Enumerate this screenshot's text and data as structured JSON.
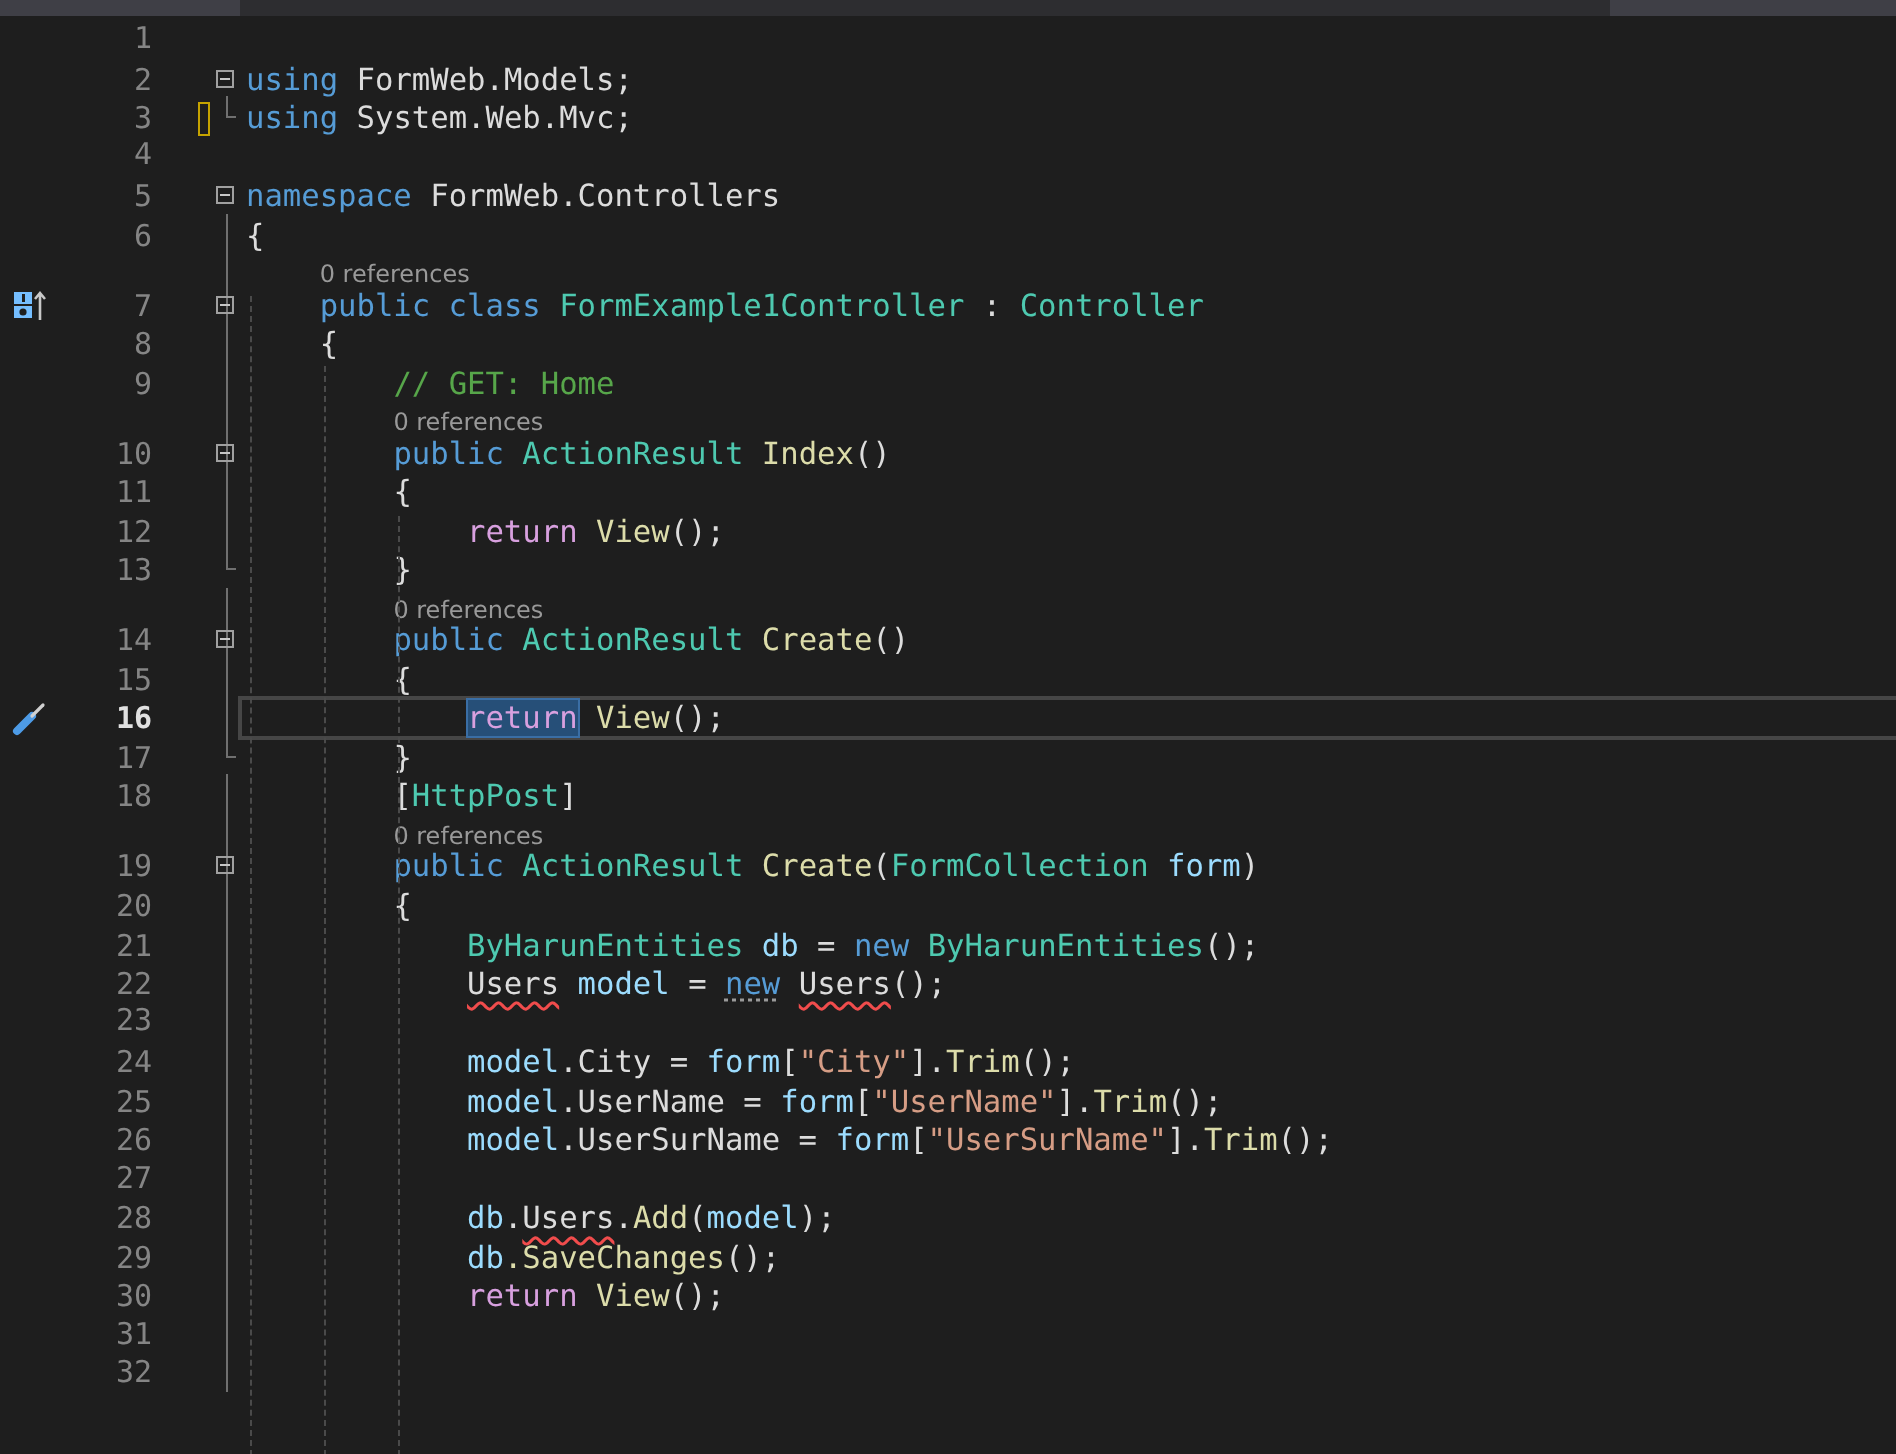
{
  "lines": [
    {
      "n": "1"
    },
    {
      "n": "2",
      "kind": "start",
      "tokens": [
        {
          "kind": "kw",
          "text": "using"
        },
        {
          "kind": "plain",
          "text": " FormWeb.Models;"
        }
      ]
    },
    {
      "n": "3",
      "kind": "end",
      "changed": true,
      "tokens": [
        {
          "kind": "kw",
          "text": "using"
        },
        {
          "kind": "plain",
          "text": " System.Web.Mvc;"
        }
      ]
    },
    {
      "n": "4"
    },
    {
      "n": "5",
      "kind": "start",
      "tokens": [
        {
          "kind": "kw",
          "text": "namespace"
        },
        {
          "kind": "plain",
          "text": " FormWeb.Controllers"
        }
      ]
    },
    {
      "n": "6",
      "kind": "body",
      "tokens": [
        {
          "kind": "plain",
          "text": "{"
        }
      ]
    },
    {
      "n": "7",
      "kind": "start",
      "diagram": true,
      "lens": "0 references",
      "tokens": [
        {
          "kind": "kw",
          "text": "    public class "
        },
        {
          "kind": "type",
          "text": "FormExample1Controller"
        },
        {
          "kind": "plain",
          "text": " : "
        },
        {
          "kind": "type",
          "text": "Controller"
        }
      ]
    },
    {
      "n": "8",
      "kind": "body",
      "tokens": [
        {
          "kind": "plain",
          "text": "    {"
        }
      ]
    },
    {
      "n": "9",
      "kind": "body",
      "tokens": [
        {
          "kind": "cmt",
          "text": "        // GET: Home"
        }
      ]
    },
    {
      "n": "10",
      "kind": "start",
      "lens": "0 references",
      "tokens": [
        {
          "kind": "kw",
          "text": "        public "
        },
        {
          "kind": "type",
          "text": "ActionResult "
        },
        {
          "kind": "fn",
          "text": "Index"
        },
        {
          "kind": "plain",
          "text": "()"
        }
      ]
    },
    {
      "n": "11",
      "kind": "body",
      "tokens": [
        {
          "kind": "plain",
          "text": "        {"
        }
      ]
    },
    {
      "n": "12",
      "kind": "body",
      "tokens": [
        {
          "kind": "ctl",
          "text": "            return "
        },
        {
          "kind": "fn",
          "text": "View"
        },
        {
          "kind": "plain",
          "text": "();"
        }
      ]
    },
    {
      "n": "13",
      "kind": "end",
      "tokens": [
        {
          "kind": "plain",
          "text": "        }"
        }
      ]
    },
    {
      "n": "14",
      "kind": "start",
      "lens": "0 references",
      "tokens": [
        {
          "kind": "kw",
          "text": "        public "
        },
        {
          "kind": "type",
          "text": "ActionResult "
        },
        {
          "kind": "fn",
          "text": "Create"
        },
        {
          "kind": "plain",
          "text": "()"
        }
      ]
    },
    {
      "n": "15",
      "kind": "body",
      "tokens": [
        {
          "kind": "plain",
          "text": "        {"
        }
      ]
    },
    {
      "n": "16",
      "kind": "body",
      "current": true,
      "tokens": [
        {
          "kind": "ctl",
          "text": "            return",
          "highlight": true
        },
        {
          "kind": "fn",
          "text": " View"
        },
        {
          "kind": "plain",
          "text": "();"
        }
      ]
    },
    {
      "n": "17",
      "kind": "end",
      "tokens": [
        {
          "kind": "plain",
          "text": "        }"
        }
      ]
    },
    {
      "n": "18",
      "kind": "body",
      "tokens": [
        {
          "kind": "plain",
          "text": "        ["
        },
        {
          "kind": "type",
          "text": "HttpPost"
        },
        {
          "kind": "plain",
          "text": "]"
        }
      ]
    },
    {
      "n": "19",
      "kind": "start",
      "lens": "0 references",
      "tokens": [
        {
          "kind": "kw",
          "text": "        public "
        },
        {
          "kind": "type",
          "text": "ActionResult "
        },
        {
          "kind": "fn",
          "text": "Create"
        },
        {
          "kind": "plain",
          "text": "("
        },
        {
          "kind": "type",
          "text": "FormCollection "
        },
        {
          "kind": "var",
          "text": "form"
        },
        {
          "kind": "plain",
          "text": ")"
        }
      ]
    },
    {
      "n": "20",
      "kind": "body",
      "tokens": [
        {
          "kind": "plain",
          "text": "        {"
        }
      ]
    },
    {
      "n": "21",
      "kind": "body",
      "tokens": [
        {
          "kind": "type",
          "text": "            ByHarunEntities "
        },
        {
          "kind": "var",
          "text": "db"
        },
        {
          "kind": "plain",
          "text": " = "
        },
        {
          "kind": "kw",
          "text": "new "
        },
        {
          "kind": "type",
          "text": "ByHarunEntities"
        },
        {
          "kind": "plain",
          "text": "();"
        }
      ]
    },
    {
      "n": "22",
      "kind": "body",
      "tokens": [
        {
          "kind": "plain",
          "text": "            Users",
          "error": true
        },
        {
          "kind": "var",
          "text": " model"
        },
        {
          "kind": "plain",
          "text": " = "
        },
        {
          "kind": "kw",
          "text": "new ",
          "hint": true
        },
        {
          "kind": "plain",
          "text": "Users",
          "error": true
        },
        {
          "kind": "plain",
          "text": "();"
        }
      ]
    },
    {
      "n": "23",
      "kind": "body"
    },
    {
      "n": "24",
      "kind": "body",
      "tokens": [
        {
          "kind": "var",
          "text": "            model"
        },
        {
          "kind": "plain",
          "text": ".City = "
        },
        {
          "kind": "var",
          "text": "form"
        },
        {
          "kind": "plain",
          "text": "["
        },
        {
          "kind": "str",
          "text": "\"City\""
        },
        {
          "kind": "plain",
          "text": "]."
        },
        {
          "kind": "fn",
          "text": "Trim"
        },
        {
          "kind": "plain",
          "text": "();"
        }
      ]
    },
    {
      "n": "25",
      "kind": "body",
      "tokens": [
        {
          "kind": "var",
          "text": "            model"
        },
        {
          "kind": "plain",
          "text": ".UserName = "
        },
        {
          "kind": "var",
          "text": "form"
        },
        {
          "kind": "plain",
          "text": "["
        },
        {
          "kind": "str",
          "text": "\"UserName\""
        },
        {
          "kind": "plain",
          "text": "]."
        },
        {
          "kind": "fn",
          "text": "Trim"
        },
        {
          "kind": "plain",
          "text": "();"
        }
      ]
    },
    {
      "n": "26",
      "kind": "body",
      "tokens": [
        {
          "kind": "var",
          "text": "            model"
        },
        {
          "kind": "plain",
          "text": ".UserSurName = "
        },
        {
          "kind": "var",
          "text": "form"
        },
        {
          "kind": "plain",
          "text": "["
        },
        {
          "kind": "str",
          "text": "\"UserSurName\""
        },
        {
          "kind": "plain",
          "text": "]."
        },
        {
          "kind": "fn",
          "text": "Trim"
        },
        {
          "kind": "plain",
          "text": "();"
        }
      ]
    },
    {
      "n": "27",
      "kind": "body"
    },
    {
      "n": "28",
      "kind": "body",
      "tokens": [
        {
          "kind": "var",
          "text": "            db"
        },
        {
          "kind": "plain",
          "text": "."
        },
        {
          "kind": "plain",
          "text": "Users",
          "error": true
        },
        {
          "kind": "plain",
          "text": "."
        },
        {
          "kind": "fn",
          "text": "Add"
        },
        {
          "kind": "plain",
          "text": "("
        },
        {
          "kind": "var",
          "text": "model"
        },
        {
          "kind": "plain",
          "text": ");"
        }
      ]
    },
    {
      "n": "29",
      "kind": "body",
      "tokens": [
        {
          "kind": "var",
          "text": "            db"
        },
        {
          "kind": "fn",
          "text": ".SaveChanges"
        },
        {
          "kind": "plain",
          "text": "();"
        }
      ]
    },
    {
      "n": "30",
      "kind": "body",
      "tokens": [
        {
          "kind": "ctl",
          "text": "            return "
        },
        {
          "kind": "fn",
          "text": "View"
        },
        {
          "kind": "plain",
          "text": "();"
        }
      ]
    },
    {
      "n": "31",
      "kind": "body"
    },
    {
      "n": "32",
      "kind": "body"
    }
  ]
}
